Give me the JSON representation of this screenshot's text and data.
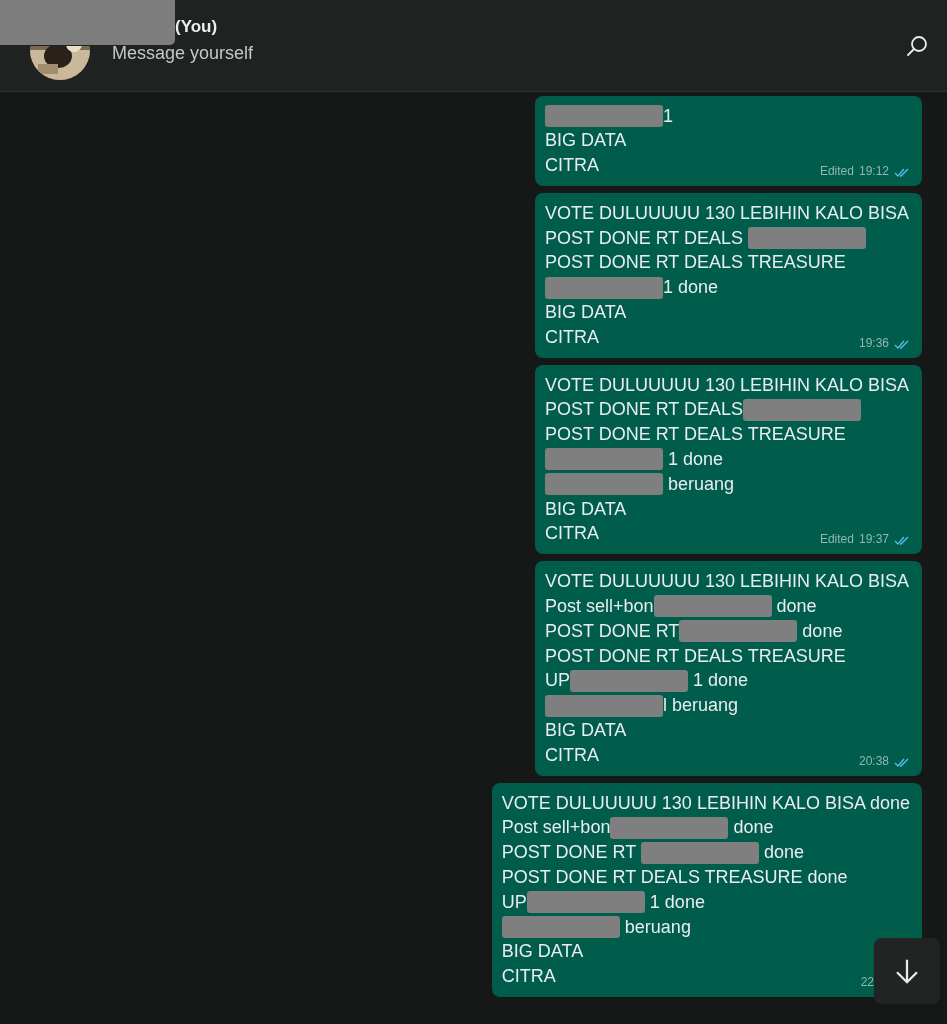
{
  "header": {
    "name": "(You)",
    "subtitle": "Message yourself"
  },
  "messages": [
    {
      "edited_label": "Edited",
      "time": "19:12",
      "read": true,
      "lines": [
        [
          {
            "kind": "redaction"
          },
          {
            "kind": "text",
            "text": "1"
          }
        ],
        [
          {
            "kind": "text",
            "text": "BIG DATA"
          }
        ],
        [
          {
            "kind": "text",
            "text": "CITRA"
          }
        ]
      ]
    },
    {
      "time": "19:36",
      "read": true,
      "lines": [
        [
          {
            "kind": "text",
            "text": "VOTE DULUUUUU 130 LEBIHIN KALO BISA"
          }
        ],
        [
          {
            "kind": "text",
            "text": "POST DONE RT DEALS "
          },
          {
            "kind": "redaction"
          }
        ],
        [
          {
            "kind": "text",
            "text": "POST DONE RT DEALS TREASURE"
          }
        ],
        [
          {
            "kind": "redaction"
          },
          {
            "kind": "text",
            "text": "1 done"
          }
        ],
        [
          {
            "kind": "text",
            "text": "BIG DATA"
          }
        ],
        [
          {
            "kind": "text",
            "text": "CITRA"
          }
        ]
      ]
    },
    {
      "edited_label": "Edited",
      "time": "19:37",
      "read": true,
      "lines": [
        [
          {
            "kind": "text",
            "text": "VOTE DULUUUUU 130 LEBIHIN KALO BISA"
          }
        ],
        [
          {
            "kind": "text",
            "text": "POST DONE RT DEALS"
          },
          {
            "kind": "redaction"
          }
        ],
        [
          {
            "kind": "text",
            "text": "POST DONE RT DEALS TREASURE"
          }
        ],
        [
          {
            "kind": "redaction"
          },
          {
            "kind": "text",
            "text": " 1 done"
          }
        ],
        [
          {
            "kind": "redaction"
          },
          {
            "kind": "text",
            "text": " beruang"
          }
        ],
        [
          {
            "kind": "text",
            "text": "BIG DATA"
          }
        ],
        [
          {
            "kind": "text",
            "text": "CITRA"
          }
        ]
      ]
    },
    {
      "time": "20:38",
      "read": true,
      "lines": [
        [
          {
            "kind": "text",
            "text": "VOTE DULUUUUU 130 LEBIHIN KALO BISA"
          }
        ],
        [
          {
            "kind": "text",
            "text": "Post sell+bon"
          },
          {
            "kind": "redaction"
          },
          {
            "kind": "text",
            "text": " done"
          }
        ],
        [
          {
            "kind": "text",
            "text": "POST DONE RT"
          },
          {
            "kind": "redaction"
          },
          {
            "kind": "text",
            "text": " done"
          }
        ],
        [
          {
            "kind": "text",
            "text": "POST DONE RT DEALS TREASURE"
          }
        ],
        [
          {
            "kind": "text",
            "text": "UP"
          },
          {
            "kind": "redaction"
          },
          {
            "kind": "text",
            "text": " 1 done"
          }
        ],
        [
          {
            "kind": "redaction"
          },
          {
            "kind": "text",
            "text": "l beruang"
          }
        ],
        [
          {
            "kind": "text",
            "text": "BIG DATA"
          }
        ],
        [
          {
            "kind": "text",
            "text": "CITRA"
          }
        ]
      ]
    },
    {
      "time": "22",
      "lines": [
        [
          {
            "kind": "text",
            "text": "VOTE DULUUUUU 130 LEBIHIN KALO BISA done"
          }
        ],
        [
          {
            "kind": "text",
            "text": "Post sell+bon"
          },
          {
            "kind": "redaction"
          },
          {
            "kind": "text",
            "text": " done"
          }
        ],
        [
          {
            "kind": "text",
            "text": "POST DONE RT "
          },
          {
            "kind": "redaction"
          },
          {
            "kind": "text",
            "text": " done"
          }
        ],
        [
          {
            "kind": "text",
            "text": "POST DONE RT DEALS TREASURE done"
          }
        ],
        [
          {
            "kind": "text",
            "text": "UP"
          },
          {
            "kind": "redaction"
          },
          {
            "kind": "text",
            "text": " 1 done"
          }
        ],
        [
          {
            "kind": "redaction"
          },
          {
            "kind": "text",
            "text": " beruang"
          }
        ],
        [
          {
            "kind": "text",
            "text": "BIG DATA"
          }
        ],
        [
          {
            "kind": "text",
            "text": "CITRA"
          }
        ]
      ]
    }
  ]
}
